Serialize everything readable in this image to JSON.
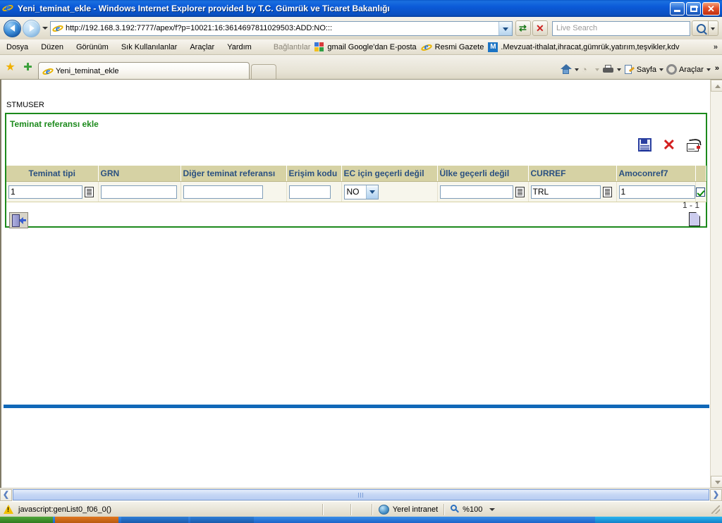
{
  "window": {
    "title": "Yeni_teminat_ekle - Windows Internet Explorer provided by T.C. Gümrük ve Ticaret Bakanlığı",
    "minimize_label": "Minimize",
    "restore_label": "Restore",
    "close_label": "Close"
  },
  "address_bar": {
    "url": "http://192.168.3.192:7777/apex/f?p=10021:16:3614697811029503:ADD:NO:::",
    "back_label": "Back",
    "forward_label": "Forward",
    "recent_pages_label": "Recent Pages",
    "refresh_label": "Refresh",
    "stop_label": "Stop",
    "search_placeholder": "Live Search",
    "search_value": "",
    "search_go_label": "Search"
  },
  "menu": {
    "items": [
      {
        "label": "Dosya",
        "accel": "D"
      },
      {
        "label": "Düzen",
        "accel": "z"
      },
      {
        "label": "Görünüm",
        "accel": "G"
      },
      {
        "label": "Sık Kullanılanlar",
        "accel": "S"
      },
      {
        "label": "Araçlar",
        "accel": "A"
      },
      {
        "label": "Yardım",
        "accel": "Y"
      }
    ],
    "links_label": "Bağlantılar",
    "links": [
      {
        "label": "gmail Google'dan E-posta",
        "icon": "google-icon"
      },
      {
        "label": "Resmi Gazete",
        "icon": "ie-icon"
      },
      {
        "label": ".Mevzuat-ithalat,ihracat,gümrük,yatırım,teşvikler,kdv",
        "icon": "m-icon"
      }
    ],
    "overflow_label": "»"
  },
  "tabs": {
    "favorites_label": "Sık Kullanılanlar",
    "add_favorite_label": "Sık Kullanılanlara Ekle",
    "items": [
      {
        "label": "Yeni_teminat_ekle",
        "active": true
      }
    ],
    "new_tab_label": "Yeni Sekme"
  },
  "command_bar": {
    "home_label": "Giriş",
    "feeds_label": "Beslemeler",
    "print_label": "Yazdır",
    "page_label": "Sayfa",
    "tools_label": "Araçlar",
    "overflow_label": "»"
  },
  "page": {
    "breadcrumb": "STMUSER",
    "region_title": "Teminat referansı ekle",
    "region_actions": [
      {
        "name": "save-icon",
        "label": "Kaydet"
      },
      {
        "name": "delete-icon",
        "label": "Sil"
      },
      {
        "name": "create-icon",
        "label": "Oluştur"
      }
    ],
    "grid": {
      "columns": [
        "Teminat tipi",
        "GRN",
        "Diğer teminat referansı",
        "Erişim kodu",
        "EC için geçerli değil",
        "Ülke geçerli değil",
        "CURREF",
        "Amoconref7",
        ""
      ],
      "rows": [
        {
          "teminat_tipi": "1",
          "grn": "",
          "diger_teminat_referansi": "",
          "erisim_kodu": "",
          "ec_icin_gecerli_degil": "NO",
          "ulke_gecerli_degil": "",
          "curref": "TRL",
          "amoconref7": "1",
          "selected": true
        }
      ]
    },
    "row_count": "1 - 1",
    "exit_label": "Çıkış",
    "new_row_label": "Yeni satır"
  },
  "status_bar": {
    "message": "javascript:genList0_f06_0()",
    "zone": "Yerel intranet",
    "zoom": "%100"
  },
  "colors": {
    "title_bar": "#0b5ad8",
    "region_border": "#1c8a1c",
    "region_title": "#1c8a1c",
    "grid_header_bg": "#d6d2a4",
    "grid_header_text": "#2a5080",
    "grid_row_bg": "#f7f6ec",
    "blue_divider": "#1068b8",
    "toolbar_bg": "#ece8dc"
  }
}
